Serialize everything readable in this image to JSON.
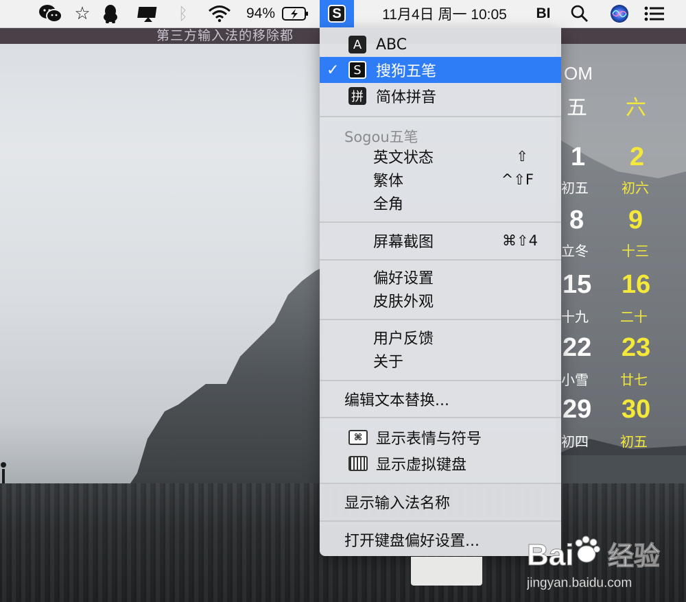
{
  "menubar": {
    "battery_percent": "94%",
    "datetime": "11月4日 周一  10:05",
    "user_initials": "BI",
    "icons": [
      "wechat-icon",
      "star-icon",
      "qq-icon",
      "airplay-icon",
      "bluetooth-icon",
      "wifi-icon",
      "battery-icon",
      "sogou-input-icon",
      "search-icon",
      "siri-icon",
      "notification-list-icon"
    ]
  },
  "wallpaper": {
    "stripe_text": "第三方输入法的移除都"
  },
  "calendar": {
    "month_label": "OM",
    "weekdays": [
      "五",
      "六"
    ],
    "days": [
      {
        "day": "1",
        "lunar": "初五"
      },
      {
        "day": "2",
        "lunar": "初六"
      },
      {
        "day": "8",
        "lunar": "立冬"
      },
      {
        "day": "9",
        "lunar": "十三"
      },
      {
        "day": "15",
        "lunar": "十九"
      },
      {
        "day": "16",
        "lunar": "二十"
      },
      {
        "day": "22",
        "lunar": "小雪"
      },
      {
        "day": "23",
        "lunar": "廿七"
      },
      {
        "day": "29",
        "lunar": "初四"
      },
      {
        "day": "30",
        "lunar": "初五"
      }
    ]
  },
  "menu": {
    "input_sources": [
      {
        "icon": "A",
        "label": "ABC",
        "selected": false
      },
      {
        "icon": "S",
        "label": "搜狗五笔",
        "selected": true
      },
      {
        "icon": "拼",
        "label": "简体拼音",
        "selected": false
      }
    ],
    "check_mark": "✓",
    "section_title": "Sogou五笔",
    "mode_items": [
      {
        "label": "英文状态",
        "shortcut": "⇧"
      },
      {
        "label": "繁体",
        "shortcut": "^⇧F"
      },
      {
        "label": "全角",
        "shortcut": ""
      }
    ],
    "screenshot": {
      "label": "屏幕截图",
      "shortcut": "⌘⇧4"
    },
    "preferences": "偏好设置",
    "skin": "皮肤外观",
    "feedback": "用户反馈",
    "about": "关于",
    "edit_text_replacement": "编辑文本替换...",
    "show_emoji": "显示表情与符号",
    "show_keyboard_viewer": "显示虚拟键盘",
    "show_input_name": "显示输入法名称",
    "open_keyboard_prefs": "打开键盘偏好设置..."
  },
  "watermark": {
    "brand": "Bai",
    "brand_suffix": "经验",
    "url": "jingyan.baidu.com"
  },
  "colors": {
    "accent": "#2f7df6",
    "calendar_weekend": "#f4e93a"
  }
}
